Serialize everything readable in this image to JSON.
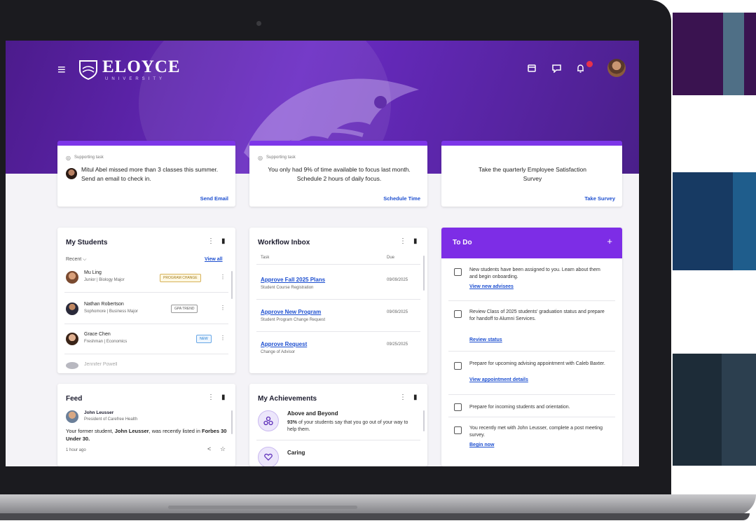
{
  "brand": {
    "name": "ELOYCE",
    "sub": "UNIVERSITY"
  },
  "topbar": {
    "hamburger": "≡",
    "icons": [
      "calendar-icon",
      "chat-icon",
      "bell-icon",
      "avatar"
    ],
    "calendar_glyph": "▭",
    "chat_glyph": "▢",
    "bell_glyph": "🔔"
  },
  "tasks": [
    {
      "label": "Supporting task",
      "text": "Mitul Abel missed more than 3 classes this summer. Send an email to check in.",
      "link": "Send Email"
    },
    {
      "label": "Supporting task",
      "text": "You only had 9% of time available to focus last month. Schedule 2 hours of daily focus.",
      "link": "Schedule Time"
    },
    {
      "label": "",
      "text": "Take the quarterly Employee Satisfaction Survey",
      "link": "Take Survey"
    }
  ],
  "my_students": {
    "title": "My Students",
    "filter": "Recent ⌵",
    "view_all": "View all",
    "students": [
      {
        "name": "Mu Ling",
        "detail": "Junior | Biology Major",
        "badge": "PROGRAM CHANGE"
      },
      {
        "name": "Nathan Robertson",
        "detail": "Sophomore | Business Major",
        "badge": "GPA TREND"
      },
      {
        "name": "Grace Chen",
        "detail": "Freshman | Economics",
        "badge": "NEW"
      },
      {
        "name": "Jennifer Powell",
        "detail": "",
        "badge": ""
      }
    ]
  },
  "workflow": {
    "title": "Workflow Inbox",
    "col_task": "Task",
    "col_due": "Due",
    "items": [
      {
        "title": "Approve Fall 2025 Plans",
        "sub": "Student Course Registration",
        "due": "09/09/2025"
      },
      {
        "title": "Approve New Program",
        "sub": "Student Program Change Request",
        "due": "09/09/2025"
      },
      {
        "title": "Approve Request",
        "sub": "Change of Advisor",
        "due": "09/25/2025"
      }
    ]
  },
  "todo": {
    "title": "To Do",
    "plus": "+",
    "items": [
      {
        "text": "New students have been assigned to you. Learn about them and begin onboarding.",
        "link": "View new advisees"
      },
      {
        "text": "Review Class of 2025 students' graduation status and prepare for handoff to Alumni Services.",
        "link": "Review status"
      },
      {
        "text": "Prepare for upcoming advising appointment with Caleb Baxter.",
        "link": "View appointment details"
      },
      {
        "text": "Prepare for incoming students and orientation.",
        "link": ""
      },
      {
        "text": "You recently met with John Leusser, complete a post meeting survey.",
        "link": "Begin now"
      }
    ]
  },
  "feed": {
    "title": "Feed",
    "author": "John Leusser",
    "role": "President of Carefree Health",
    "text_a": "Your former student, ",
    "text_b": "John Leusser",
    "text_c": ", was recently listed in ",
    "text_d": "Forbes 30 Under 30.",
    "time": "1 hour ago"
  },
  "achievements": {
    "title": "My Achievements",
    "items": [
      {
        "title": "Above and Beyond",
        "bold": "93%",
        "text": " of your students say that you go out of your way to help them."
      },
      {
        "title": "Caring",
        "bold": "",
        "text": ""
      }
    ]
  },
  "glyphs": {
    "kebab": "⋮",
    "bookmark": "▮",
    "share": "<",
    "star": "☆",
    "pin": "◎"
  }
}
